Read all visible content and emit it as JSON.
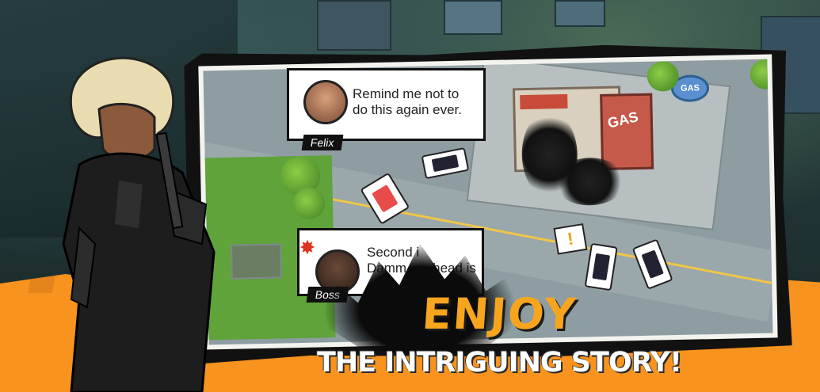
{
  "banner": {
    "headline_primary": "ENJOY",
    "headline_secondary": "THE INTRIGUING STORY!"
  },
  "map": {
    "gas_sign_label": "GAS",
    "station_sign_label": "GAS"
  },
  "dialogue": [
    {
      "speaker": "Felix",
      "text_line1": "Remind me not to",
      "text_line2": "do this again ever."
    },
    {
      "speaker": "Boss",
      "text_line1": "Second i",
      "text_line2": "Damm... ...head is"
    }
  ],
  "icons": {
    "alert": "anger-icon",
    "warning": "exclamation-icon"
  },
  "colors": {
    "accent_orange": "#f7931e",
    "headline_orange": "#f7a51e"
  }
}
